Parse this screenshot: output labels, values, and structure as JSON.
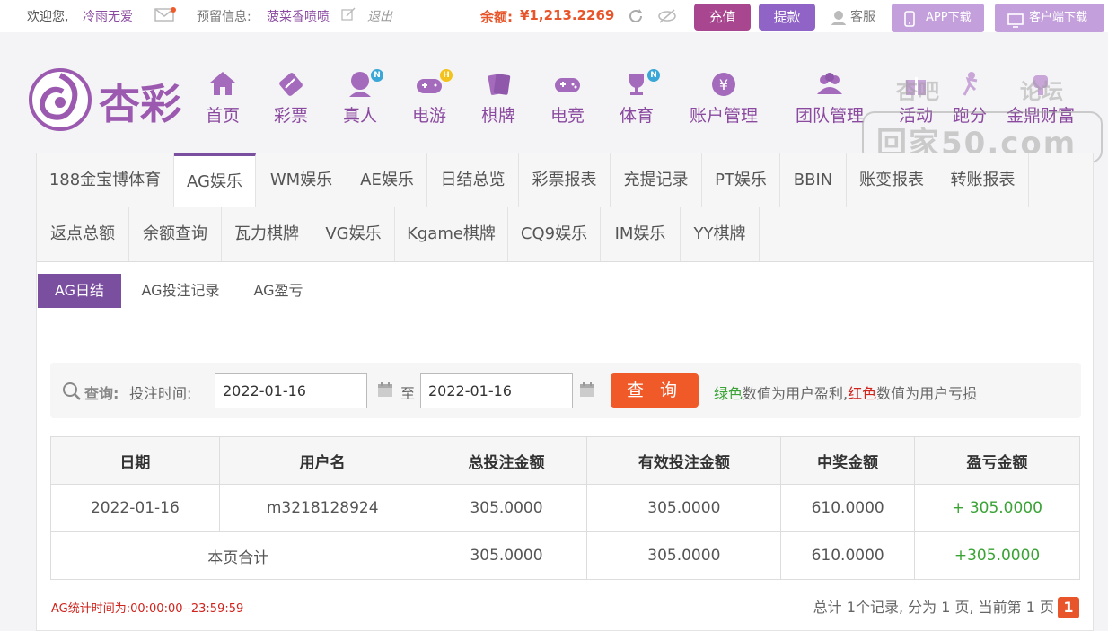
{
  "topbar": {
    "welcome": "欢迎您,",
    "username": "冷雨无爱",
    "reserved_label": "预留信息:",
    "reserved_value": "菠菜香喷喷",
    "logout": "退出",
    "balance_label": "余额:",
    "balance_value": "¥1,213.2269",
    "recharge": "充值",
    "withdraw": "提款",
    "service": "客服",
    "app_download": "APP下载",
    "client_download": "客户端下载"
  },
  "logo_text": "杏彩",
  "nav": [
    {
      "label": "首页",
      "icon": "home-icon"
    },
    {
      "label": "彩票",
      "icon": "lottery-ticket-icon"
    },
    {
      "label": "真人",
      "icon": "live-dealer-icon",
      "badge": "N"
    },
    {
      "label": "电游",
      "icon": "gamepad-icon",
      "badge": "H"
    },
    {
      "label": "棋牌",
      "icon": "cards-icon"
    },
    {
      "label": "电竞",
      "icon": "esports-controller-icon"
    },
    {
      "label": "体育",
      "icon": "trophy-icon",
      "badge": "N"
    },
    {
      "label": "账户管理",
      "icon": "yen-coin-icon"
    },
    {
      "label": "团队管理",
      "icon": "team-icon"
    },
    {
      "label": "活动",
      "icon": "gift-icon"
    },
    {
      "label": "跑分",
      "icon": "run-icon"
    },
    {
      "label": "金鼎财富",
      "icon": "wealth-icon"
    }
  ],
  "watermark": {
    "line1": "杏吧",
    "line2": "论坛",
    "line3": "回家50.com"
  },
  "tabs_row1": [
    "188金宝博体育",
    "AG娱乐",
    "WM娱乐",
    "AE娱乐",
    "日结总览",
    "彩票报表",
    "充提记录",
    "PT娱乐",
    "BBIN",
    "账变报表",
    "转账报表"
  ],
  "tabs_row2": [
    "返点总额",
    "余额查询",
    "瓦力棋牌",
    "VG娱乐",
    "Kgame棋牌",
    "CQ9娱乐",
    "IM娱乐",
    "YY棋牌"
  ],
  "subtabs": [
    "AG日结",
    "AG投注记录",
    "AG盈亏"
  ],
  "query": {
    "label": "查询:",
    "time_label": "投注时间:",
    "start_date": "2022-01-16",
    "to": "至",
    "end_date": "2022-01-16",
    "button": "查 询",
    "legend_green": "绿色",
    "legend_mid": "数值为用户盈利,",
    "legend_red": "红色",
    "legend_end": "数值为用户亏损"
  },
  "table": {
    "headers": [
      "日期",
      "用户名",
      "总投注金额",
      "有效投注金额",
      "中奖金额",
      "盈亏金额"
    ],
    "row": [
      "2022-01-16",
      "m3218128924",
      "305.0000",
      "305.0000",
      "610.0000",
      "+ 305.0000"
    ],
    "total": [
      "本页合计",
      "305.0000",
      "305.0000",
      "610.0000",
      "+305.0000"
    ]
  },
  "footnote": "AG统计时间为:00:00:00--23:59:59",
  "pager": {
    "text": "总计 1个记录, 分为 1 页, 当前第 1 页",
    "current": "1"
  },
  "colors": {
    "purple": "#7b4fa0",
    "orange": "#f05a28",
    "green": "#3aa335",
    "red": "#d0231c"
  }
}
